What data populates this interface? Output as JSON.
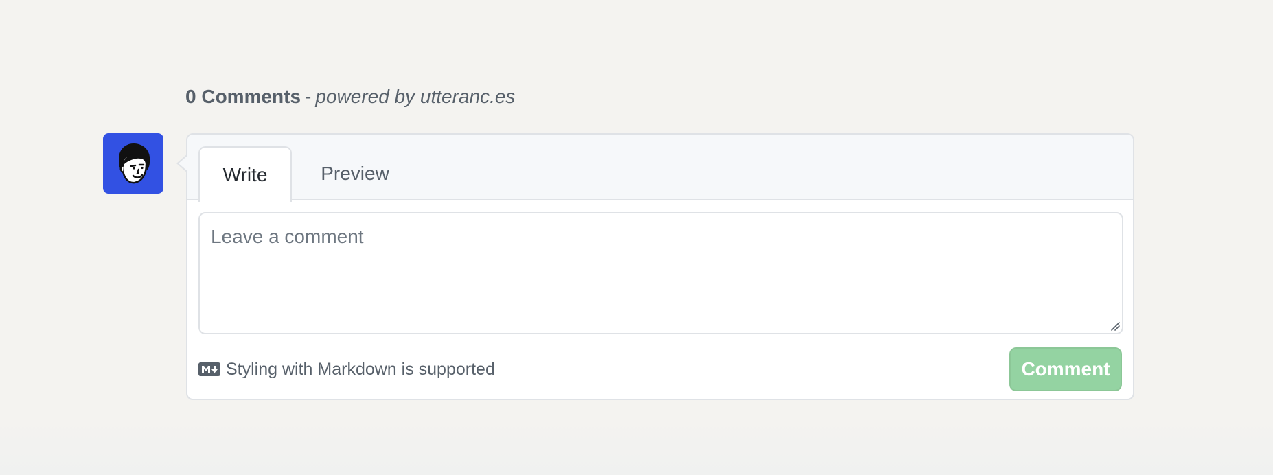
{
  "header": {
    "count_text": "0 Comments",
    "separator": "-",
    "powered_text": "powered by utteranc.es"
  },
  "avatar": {
    "icon": "user-avatar-face-icon",
    "background_color": "#3251e3"
  },
  "tabs": [
    {
      "label": "Write",
      "active": true
    },
    {
      "label": "Preview",
      "active": false
    }
  ],
  "editor": {
    "placeholder": "Leave a comment",
    "value": ""
  },
  "footer": {
    "markdown_icon": "markdown-icon",
    "markdown_note": "Styling with Markdown is supported",
    "comment_button_label": "Comment",
    "comment_button_color": "#94d3a2"
  }
}
